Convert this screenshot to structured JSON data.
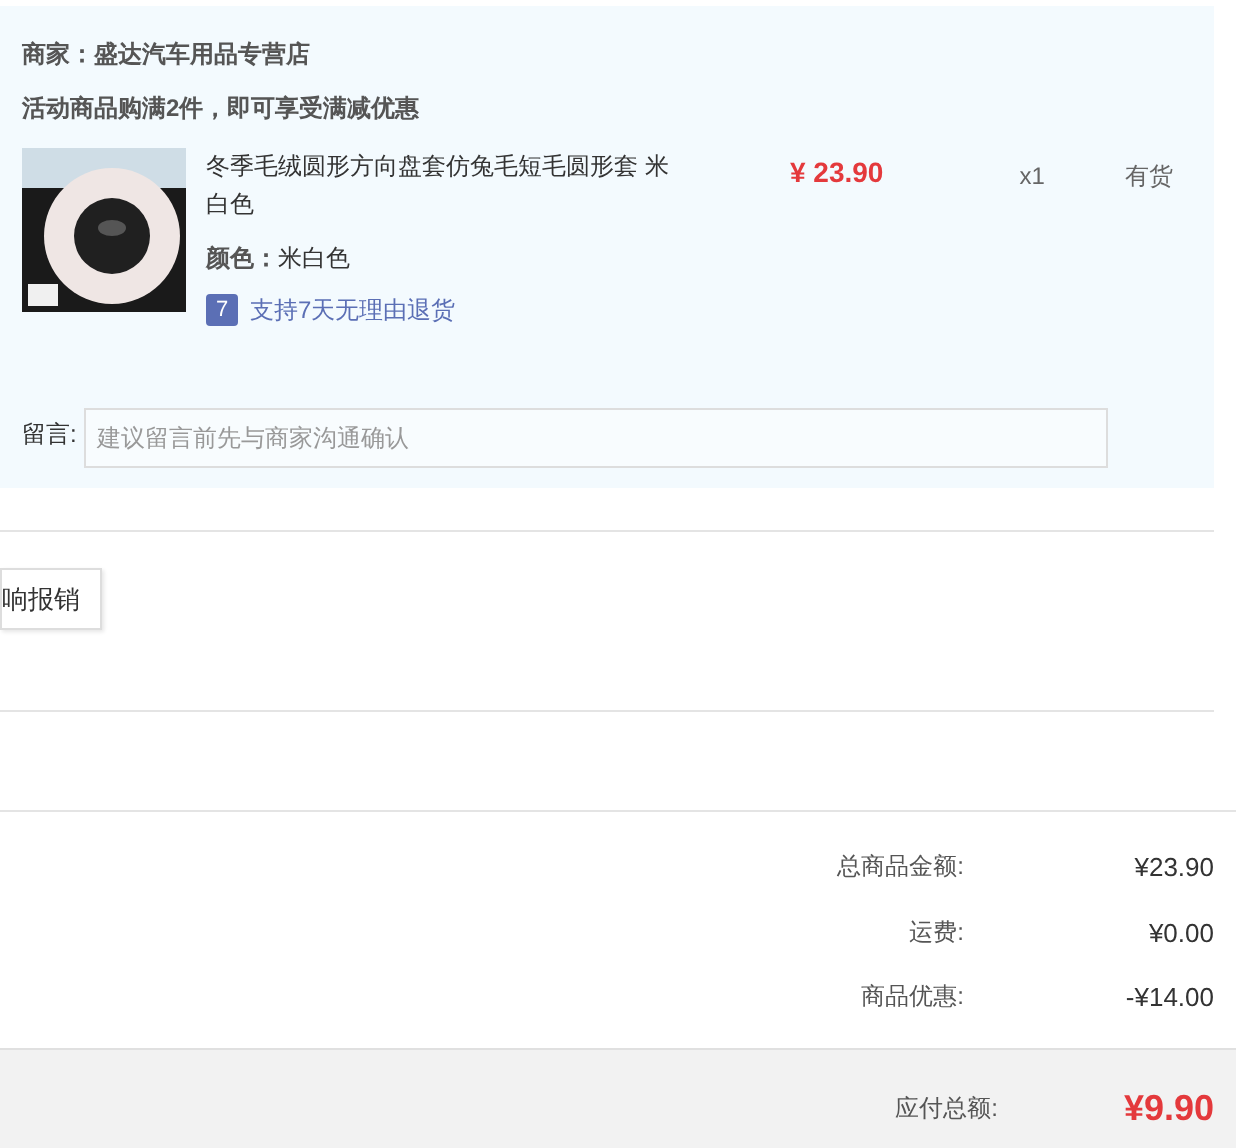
{
  "shop": {
    "merchant_label": "商家：",
    "merchant_name": "盛达汽车用品专营店",
    "promo": "活动商品购满2件，即可享受满减优惠"
  },
  "item": {
    "title": "冬季毛绒圆形方向盘套仿兔毛短毛圆形套 米白色",
    "color_label": "颜色：",
    "color_value": "米白色",
    "return_badge": "7",
    "return_policy": "支持7天无理由退货",
    "price": "¥ 23.90",
    "quantity": "x1",
    "stock": "有货"
  },
  "message": {
    "label": "留言:",
    "placeholder": "建议留言前先与商家沟通确认"
  },
  "invoice_button": "响报销",
  "summary": [
    {
      "label": "总商品金额:",
      "value": "¥23.90"
    },
    {
      "label": "运费:",
      "value": "¥0.00"
    },
    {
      "label": "商品优惠:",
      "value": "-¥14.00"
    }
  ],
  "total": {
    "label": "应付总额:",
    "value": "¥9.90"
  }
}
